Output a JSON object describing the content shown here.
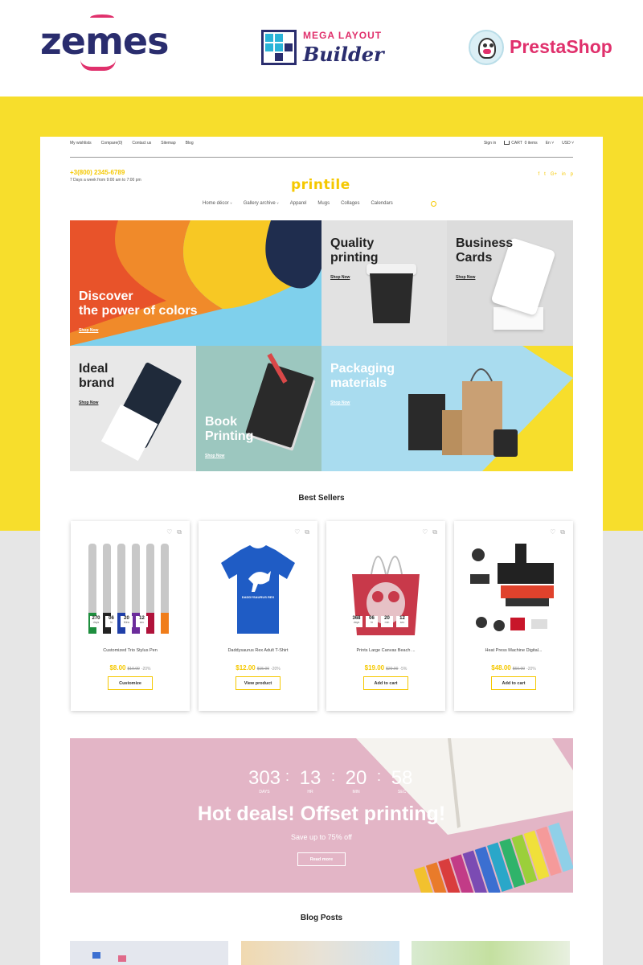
{
  "header_brands": {
    "zemes": "zemes",
    "mlb_line1": "MEGA LAYOUT",
    "mlb_line2": "Builder",
    "prestashop": "PrestaShop"
  },
  "topbar": {
    "links": [
      "My wishlists",
      "Compare(0)",
      "Contact us",
      "Sitemap",
      "Blog"
    ],
    "sign_in": "Sign in",
    "cart": "CART",
    "cart_count": "0 items",
    "lang": "En",
    "currency": "USD"
  },
  "store": {
    "phone": "+3(800) 2345-6789",
    "hours": "7 Days a week from 9:00 am to 7:00 pm",
    "logo": "printile",
    "social": [
      "f",
      "t",
      "G+",
      "in",
      "p"
    ]
  },
  "nav": {
    "items": [
      "Home décor",
      "Gallery archive",
      "Apparel",
      "Mugs",
      "Collages",
      "Calendars"
    ]
  },
  "banners": {
    "discover_l1": "Discover",
    "discover_l2": "the power of colors",
    "quality_l1": "Quality",
    "quality_l2": "printing",
    "business_l1": "Business",
    "business_l2": "Cards",
    "ideal_l1": "Ideal",
    "ideal_l2": "brand",
    "book_l1": "Book",
    "book_l2": "Printing",
    "packaging_l1": "Packaging",
    "packaging_l2": "materials",
    "shop_now": "Shop Now"
  },
  "best_sellers": {
    "title": "Best Sellers",
    "products": [
      {
        "name": "Customized Trio Stylus Pen",
        "price": "$8.00",
        "old": "$10.00",
        "disc": "-20%",
        "button": "Customize",
        "timer": [
          {
            "n": "270",
            "l": "days"
          },
          {
            "n": "06",
            "l": "hr"
          },
          {
            "n": "20",
            "l": "Mins"
          },
          {
            "n": "12",
            "l": "sec"
          }
        ]
      },
      {
        "name": "Daddysaurus Rex Adult T-Shirt",
        "price": "$12.00",
        "old": "$15.00",
        "disc": "-20%",
        "button": "View product",
        "shirt_text": "DADDYSAURUS REX"
      },
      {
        "name": "Prints Large Canvas Beach ...",
        "price": "$19.00",
        "old": "$20.00",
        "disc": "-5%",
        "button": "Add to cart",
        "timer": [
          {
            "n": "368",
            "l": "days"
          },
          {
            "n": "06",
            "l": "hr"
          },
          {
            "n": "20",
            "l": "min"
          },
          {
            "n": "12",
            "l": "sec"
          }
        ]
      },
      {
        "name": "Heat Press Machine Digital...",
        "price": "$48.00",
        "old": "$60.00",
        "disc": "-20%",
        "button": "Add to cart"
      }
    ]
  },
  "deal": {
    "timer": [
      {
        "n": "303",
        "l": "DAYS"
      },
      {
        "n": "13",
        "l": "HR"
      },
      {
        "n": "20",
        "l": "MIN"
      },
      {
        "n": "58",
        "l": "SEC"
      }
    ],
    "title": "Hot deals! Offset printing!",
    "subtitle": "Save up to 75% off",
    "button": "Read more"
  },
  "blog": {
    "title": "Blog Posts"
  }
}
